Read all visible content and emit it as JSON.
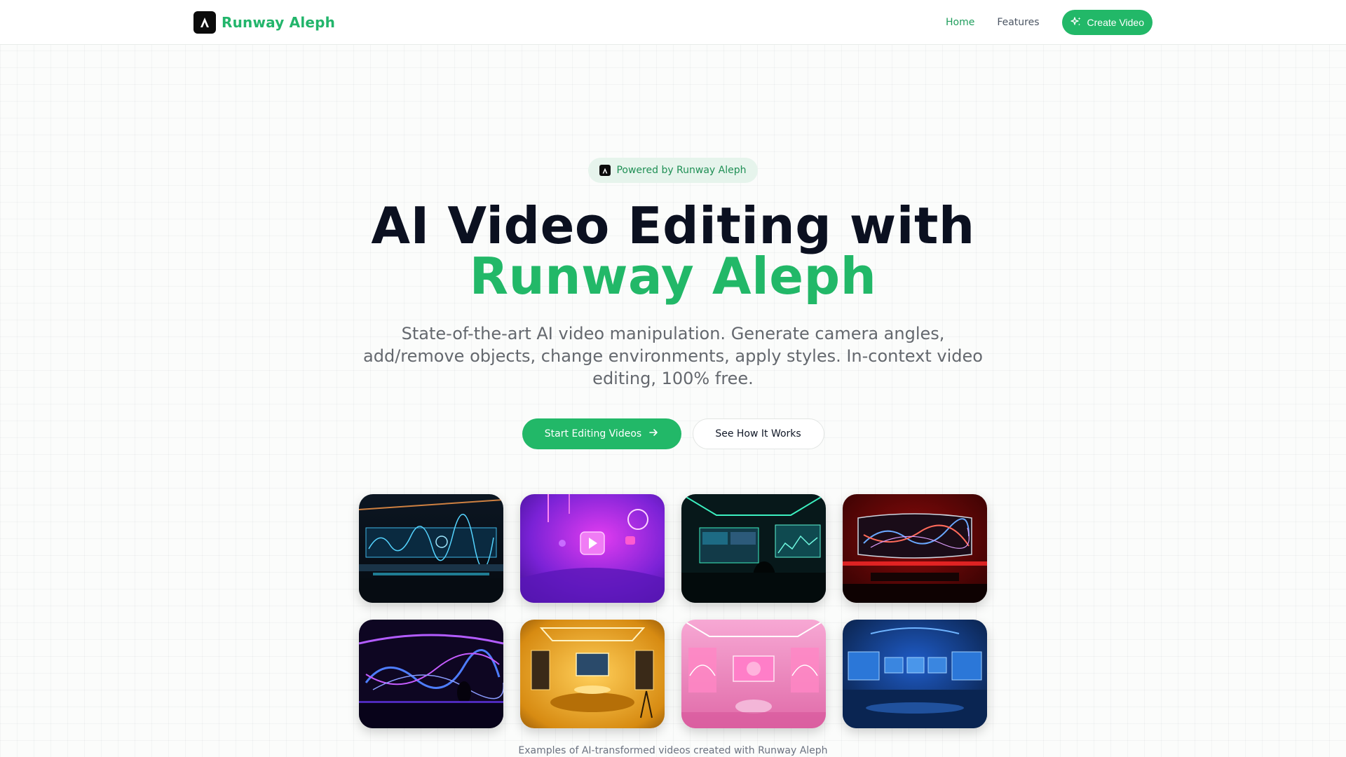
{
  "header": {
    "brand": "Runway Aleph",
    "nav": {
      "home": "Home",
      "features": "Features",
      "cta": "Create Video"
    }
  },
  "hero": {
    "badge": "Powered by Runway Aleph",
    "title_line1": "AI Video Editing with",
    "title_line2": "Runway Aleph",
    "subtitle": "State-of-the-art AI video manipulation. Generate camera angles, add/remove objects, change environments, apply styles. In-context video editing, 100% free.",
    "primary_button": "Start Editing Videos",
    "secondary_button": "See How It Works"
  },
  "gallery": {
    "caption": "Examples of AI-transformed videos created with Runway Aleph"
  },
  "colors": {
    "accent": "#22b868",
    "title": "#0b1020",
    "muted": "#64686e"
  },
  "icons": {
    "logo": "letter-a-logo-icon",
    "cta": "sparkles-icon",
    "primary": "arrow-right-icon"
  }
}
